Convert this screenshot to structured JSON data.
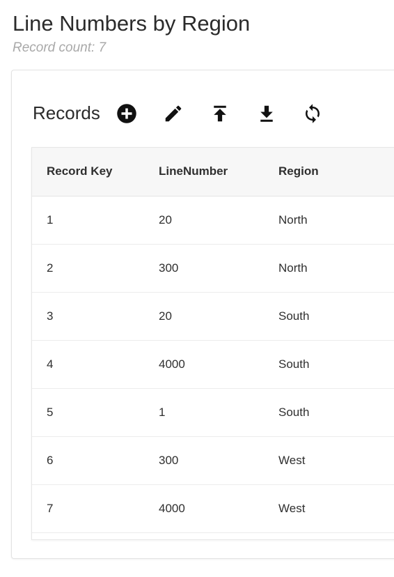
{
  "page": {
    "title": "Line Numbers by Region",
    "record_count": "Record count: 7"
  },
  "card": {
    "title": "Records",
    "toolbar": [
      {
        "name": "add-icon",
        "label": "Add"
      },
      {
        "name": "edit-icon",
        "label": "Edit"
      },
      {
        "name": "upload-icon",
        "label": "Upload"
      },
      {
        "name": "download-icon",
        "label": "Download"
      },
      {
        "name": "refresh-icon",
        "label": "Refresh"
      }
    ]
  },
  "table": {
    "columns": [
      "Record Key",
      "LineNumber",
      "Region"
    ],
    "rows": [
      [
        "1",
        "20",
        "North"
      ],
      [
        "2",
        "300",
        "North"
      ],
      [
        "3",
        "20",
        "South"
      ],
      [
        "4",
        "4000",
        "South"
      ],
      [
        "5",
        "1",
        "South"
      ],
      [
        "6",
        "300",
        "West"
      ],
      [
        "7",
        "4000",
        "West"
      ]
    ]
  }
}
